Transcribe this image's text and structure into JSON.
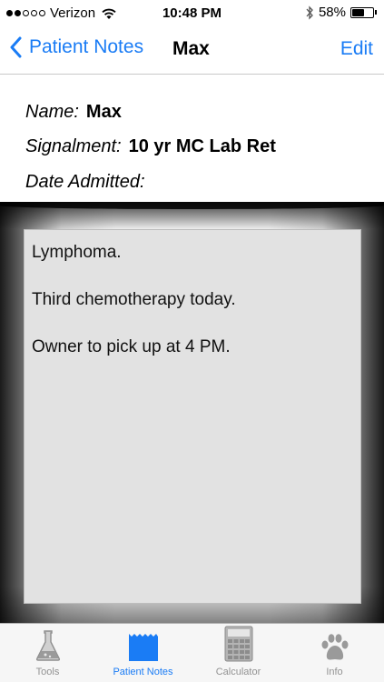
{
  "status_bar": {
    "carrier": "Verizon",
    "time": "10:48 PM",
    "battery_percent": "58%",
    "battery_level": 0.58,
    "signal_bars": 2
  },
  "nav": {
    "back_label": "Patient Notes",
    "title": "Max",
    "edit_label": "Edit"
  },
  "patient": {
    "name_label": "Name:",
    "name_value": "Max",
    "signalment_label": "Signalment:",
    "signalment_value": "10 yr MC Lab Ret",
    "date_label": "Date Admitted:",
    "date_value": ""
  },
  "notes": [
    "Lymphoma.",
    "Third chemotherapy today.",
    "Owner to pick up at 4 PM."
  ],
  "tabs": [
    {
      "label": "Tools",
      "icon": "flask-icon"
    },
    {
      "label": "Patient Notes",
      "icon": "notepad-icon"
    },
    {
      "label": "Calculator",
      "icon": "calculator-icon"
    },
    {
      "label": "Info",
      "icon": "paw-icon"
    }
  ],
  "colors": {
    "accent": "#1a7cf5",
    "tab_inactive": "#929292"
  }
}
